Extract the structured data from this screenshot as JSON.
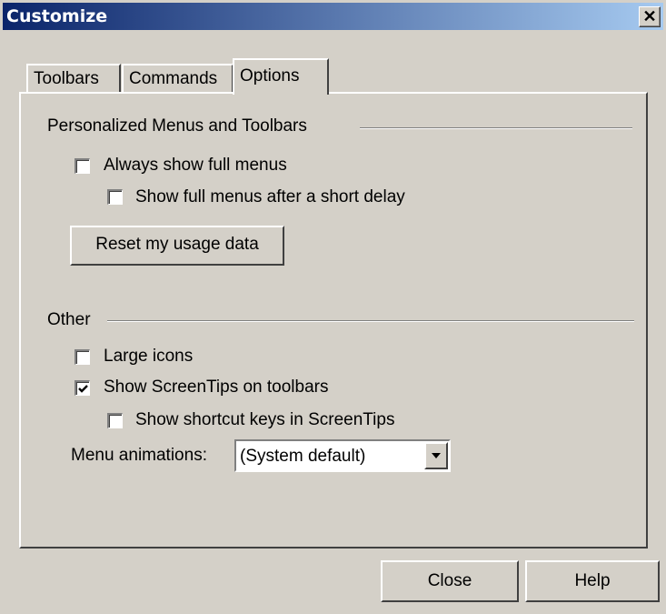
{
  "window": {
    "title": "Customize",
    "close_glyph": "✕"
  },
  "tabs": [
    {
      "label": "Toolbars",
      "active": false
    },
    {
      "label": "Commands",
      "active": false
    },
    {
      "label": "Options",
      "active": true
    }
  ],
  "personalized": {
    "heading": "Personalized Menus and Toolbars",
    "always_full_menus": {
      "label": "Always show full menus",
      "checked": false
    },
    "full_after_delay": {
      "label": "Show full menus after a short delay",
      "checked": false
    },
    "reset_label": "Reset my usage data"
  },
  "other": {
    "heading": "Other",
    "large_icons": {
      "label": "Large icons",
      "checked": false
    },
    "screentips": {
      "label": "Show ScreenTips on toolbars",
      "checked": true
    },
    "shortcut_keys": {
      "label": "Show shortcut keys in ScreenTips",
      "checked": false
    },
    "menu_animations": {
      "label": "Menu animations:",
      "value": "(System default)"
    }
  },
  "footer": {
    "close_label": "Close",
    "help_label": "Help"
  },
  "colors": {
    "face": "#d4d0c8",
    "title_start": "#0a246a",
    "title_end": "#a6caf0"
  }
}
